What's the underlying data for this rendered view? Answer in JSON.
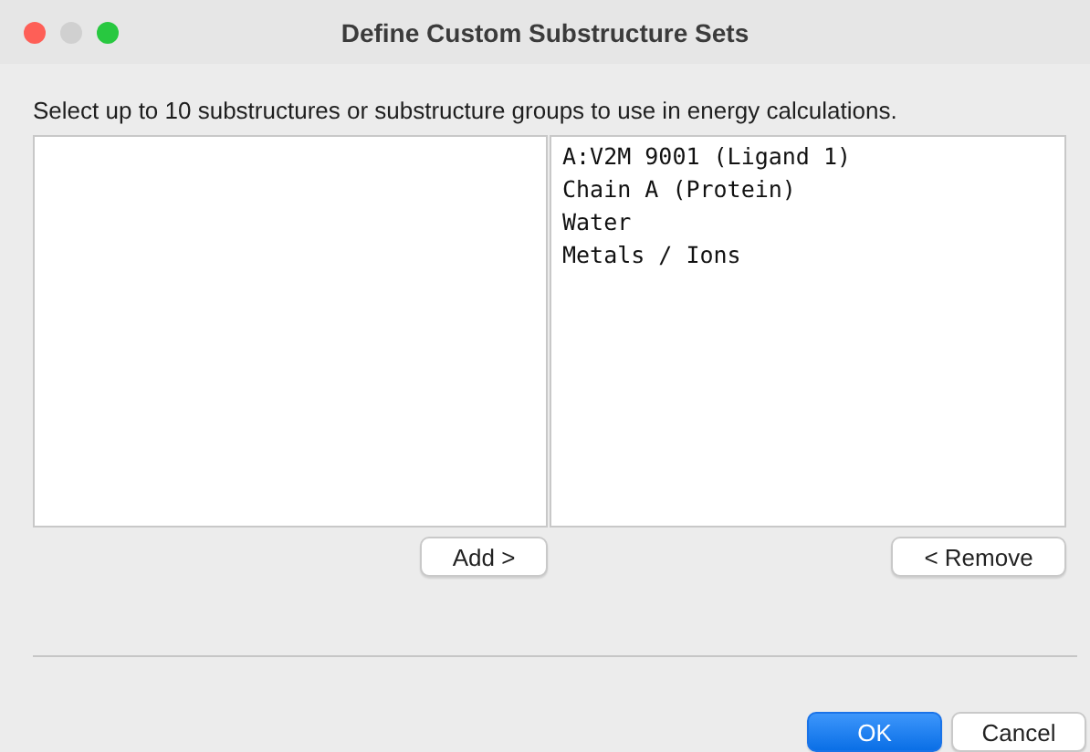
{
  "window": {
    "title": "Define Custom Substructure Sets",
    "controls": [
      {
        "kind": "close",
        "disabled": false
      },
      {
        "kind": "minimize",
        "disabled": true
      },
      {
        "kind": "zoom",
        "disabled": false
      }
    ]
  },
  "instruction": "Select up to 10 substructures or substructure groups to use in energy calculations.",
  "selected_list": {
    "items": [
      "A:V2M 9001 (Ligand 1)",
      "Chain A (Protein)",
      "Water",
      "Metals / Ions"
    ]
  },
  "add_button": "Add >",
  "remove_button": "< Remove",
  "buttons": [
    {
      "label": "OK",
      "default": true
    },
    {
      "label": "Cancel",
      "default": false
    }
  ]
}
